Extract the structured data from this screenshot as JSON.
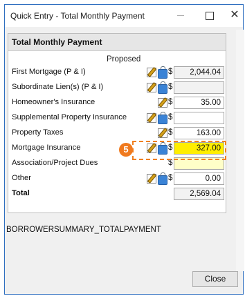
{
  "window": {
    "title": "Quick Entry - Total Monthly Payment"
  },
  "panel": {
    "header": "Total Monthly Payment",
    "column_label": "Proposed",
    "rows": [
      {
        "label": "First Mortgage (P & I)",
        "value": "2,044.04",
        "icons": [
          "edit",
          "lock"
        ]
      },
      {
        "label": "Subordinate Lien(s) (P & I)",
        "value": "",
        "icons": [
          "edit",
          "lock"
        ]
      },
      {
        "label": "Homeowner's Insurance",
        "value": "35.00",
        "icons": [
          "edit"
        ]
      },
      {
        "label": "Supplemental Property Insurance",
        "value": "",
        "icons": [
          "edit",
          "lock"
        ]
      },
      {
        "label": "Property Taxes",
        "value": "163.00",
        "icons": [
          "edit"
        ]
      },
      {
        "label": "Mortgage Insurance",
        "value": "327.00",
        "icons": [
          "edit",
          "lock"
        ]
      },
      {
        "label": "Association/Project Dues",
        "value": "",
        "icons": []
      },
      {
        "label": "Other",
        "value": "0.00",
        "icons": [
          "edit",
          "lock"
        ]
      }
    ],
    "total": {
      "label": "Total",
      "value": "2,569.04"
    },
    "currency_symbol": "$"
  },
  "callout": {
    "step_number": "5",
    "color": "#f07a1e"
  },
  "footer": {
    "field_id": "BORROWERSUMMARY_TOTALPAYMENT"
  },
  "buttons": {
    "close": "Close"
  }
}
